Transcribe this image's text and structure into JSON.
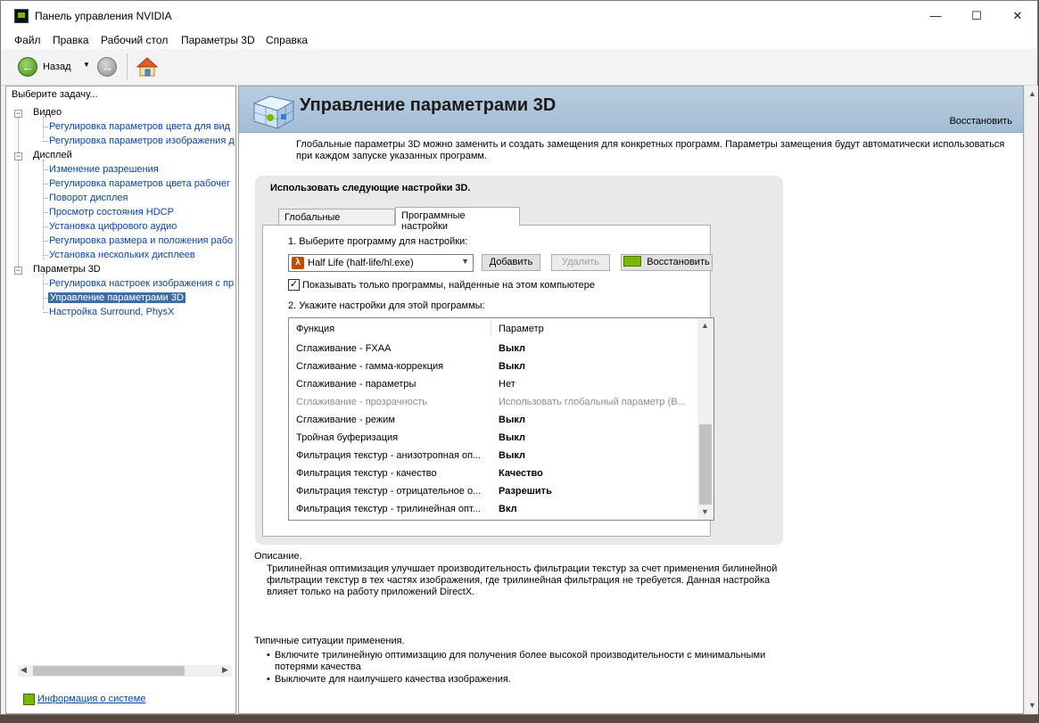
{
  "window": {
    "title": "Панель управления NVIDIA",
    "controls": {
      "minimize": "—",
      "maximize": "☐",
      "close": "✕"
    }
  },
  "menu": [
    "Файл",
    "Правка",
    "Рабочий стол",
    "Параметры 3D",
    "Справка"
  ],
  "toolbar": {
    "back_label": "Назад"
  },
  "sidebar": {
    "header": "Выберите задачу...",
    "groups": [
      {
        "label": "Видео",
        "items": [
          "Регулировка параметров цвета для вид",
          "Регулировка параметров изображения д"
        ]
      },
      {
        "label": "Дисплей",
        "items": [
          "Изменение разрешения",
          "Регулировка параметров цвета рабочег",
          "Поворот дисплея",
          "Просмотр состояния HDCP",
          "Установка цифрового аудио",
          "Регулировка размера и положения рабо",
          "Установка нескольких дисплеев"
        ]
      },
      {
        "label": "Параметры 3D",
        "items": [
          "Регулировка настроек изображения с пр",
          "Управление параметрами 3D",
          "Настройка Surround, PhysX"
        ]
      }
    ],
    "selected": "Управление параметрами 3D",
    "system_info": "Информация о системе"
  },
  "main": {
    "title": "Управление параметрами 3D",
    "restore": "Восстановить",
    "intro": "Глобальные параметры 3D можно заменить и создать замещения для конкретных программ. Параметры замещения будут автоматически использоваться при каждом запуске указанных программ.",
    "box_title": "Использовать следующие настройки 3D.",
    "tabs": [
      "Глобальные параметры",
      "Программные настройки"
    ],
    "active_tab": "Программные настройки",
    "step1": "1. Выберите программу для настройки:",
    "program": "Half Life (half-life/hl.exe)",
    "add_button": "Добавить",
    "remove_button": "Удалить",
    "restore_button": "Восстановить",
    "show_only_label": "Показывать только программы, найденные на этом компьютере",
    "show_only_checked": true,
    "step2": "2. Укажите настройки для этой программы:",
    "columns": [
      "Функция",
      "Параметр"
    ],
    "rows": [
      {
        "function": "Сглаживание - FXAA",
        "value": "Выкл",
        "bold": true,
        "dim": false
      },
      {
        "function": "Сглаживание - гамма-коррекция",
        "value": "Выкл",
        "bold": true,
        "dim": false
      },
      {
        "function": "Сглаживание - параметры",
        "value": "Нет",
        "bold": false,
        "dim": false
      },
      {
        "function": "Сглаживание - прозрачность",
        "value": "Использовать глобальный параметр (В...",
        "bold": false,
        "dim": true
      },
      {
        "function": "Сглаживание - режим",
        "value": "Выкл",
        "bold": true,
        "dim": false
      },
      {
        "function": "Тройная буферизация",
        "value": "Выкл",
        "bold": true,
        "dim": false
      },
      {
        "function": "Фильтрация текстур - анизотропная оп...",
        "value": "Выкл",
        "bold": true,
        "dim": false
      },
      {
        "function": "Фильтрация текстур - качество",
        "value": "Качество",
        "bold": true,
        "dim": false
      },
      {
        "function": "Фильтрация текстур - отрицательное о...",
        "value": "Разрешить",
        "bold": true,
        "dim": false
      },
      {
        "function": "Фильтрация текстур - трилинейная опт...",
        "value": "Вкл",
        "bold": true,
        "dim": false
      }
    ],
    "description_label": "Описание.",
    "description": "Трилинейная оптимизация улучшает производительность фильтрации текстур за счет применения билинейной фильтрации текстур в тех частях изображения, где трилинейная фильтрация не требуется. Данная настройка влияет только на работу приложений DirectX.",
    "usage_label": "Типичные ситуации применения.",
    "usage": [
      "Включите трилинейную оптимизацию для получения более высокой производительности с минимальными потерями качества",
      "Выключите для наилучшего качества изображения."
    ]
  },
  "icons": {
    "app": "nvidia-app-icon",
    "back": "back-arrow-icon",
    "forward": "forward-arrow-icon",
    "home": "home-icon",
    "cube": "3d-cube-icon",
    "nvidia_logo": "nvidia-logo-icon",
    "program": "half-life-icon"
  },
  "colors": {
    "accent": "#76b900",
    "banner": "#b9cde0",
    "link": "#0645ad",
    "selection": "#3a6ea5"
  }
}
